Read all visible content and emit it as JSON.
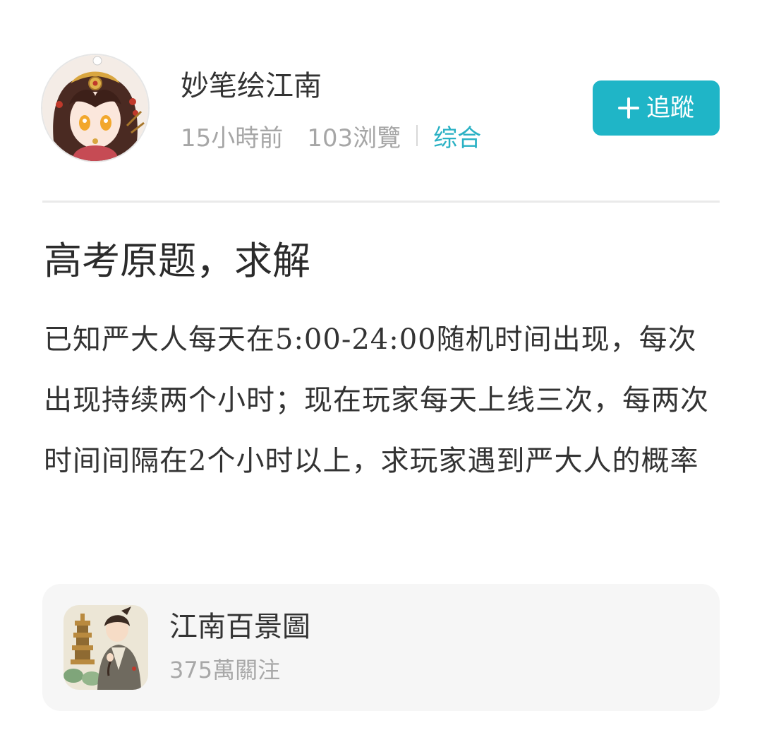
{
  "author": {
    "name": "妙笔绘江南",
    "avatar_icon": "anime-girl-avatar"
  },
  "meta": {
    "time_ago": "15小時前",
    "views": "103浏覽",
    "category": "综合"
  },
  "follow_button": {
    "label": "追蹤",
    "icon": "plus-icon",
    "color": "#1fb5c7"
  },
  "post": {
    "title": "高考原题，求解",
    "body": "已知严大人每天在5:00-24:00随机时间出现，每次出现持续两个小时；现在玩家每天上线三次，每两次时间间隔在2个小时以上，求玩家遇到严大人的概率"
  },
  "game_card": {
    "name": "江南百景圖",
    "followers": "375萬關注",
    "icon": "game-app-icon"
  },
  "colors": {
    "accent": "#1fb5c7",
    "category_text": "#2ab1c4",
    "muted_text": "#a6a6a6",
    "card_bg": "#f6f6f6"
  }
}
